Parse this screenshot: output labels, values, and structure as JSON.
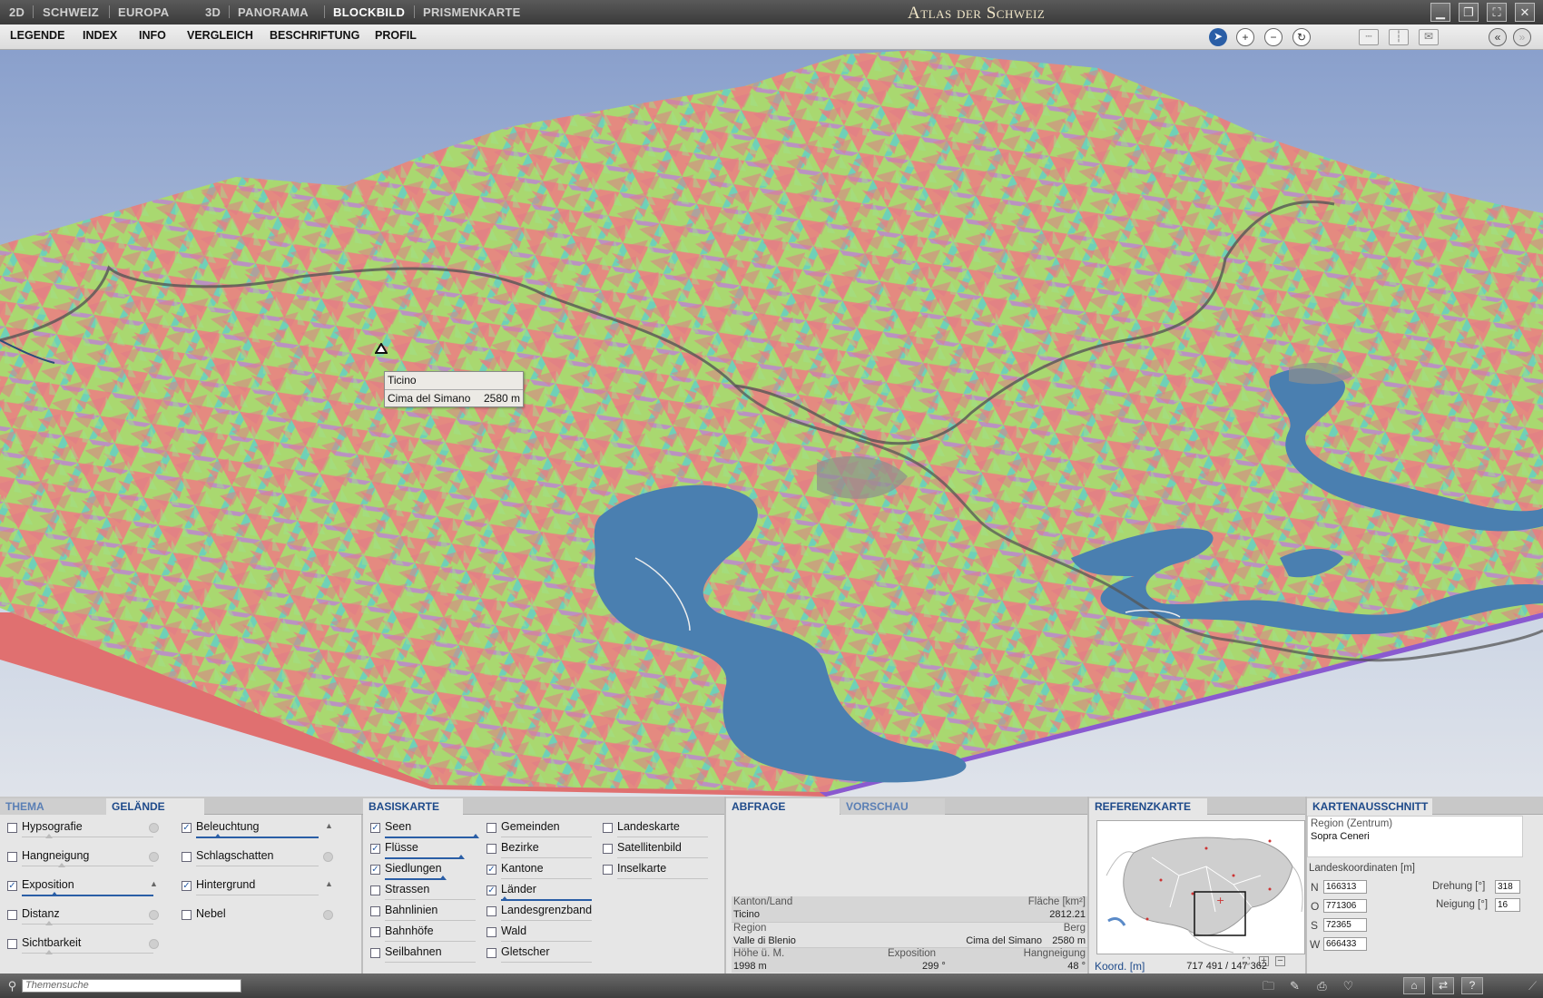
{
  "top": {
    "tabs": [
      "2D",
      "SCHWEIZ",
      "EUROPA",
      "3D",
      "PANORAMA",
      "BLOCKBILD",
      "PRISMENKARTE"
    ],
    "active_tab": "BLOCKBILD",
    "app_title": "Atlas der Schweiz"
  },
  "menu": {
    "items": [
      "LEGENDE",
      "INDEX",
      "INFO",
      "VERGLEICH",
      "BESCHRIFTUNG",
      "PROFIL"
    ]
  },
  "map": {
    "tooltip_region": "Ticino",
    "tooltip_peak": "Cima del Simano",
    "tooltip_height": "2580 m"
  },
  "thema": {
    "tabs": [
      "THEMA",
      "GELÄNDE"
    ],
    "items": [
      {
        "label": "Hypsografie",
        "checked": false
      },
      {
        "label": "Hangneigung",
        "checked": false
      },
      {
        "label": "Exposition",
        "checked": true
      },
      {
        "label": "Distanz",
        "checked": false
      },
      {
        "label": "Sichtbarkeit",
        "checked": false
      },
      {
        "label": "Beleuchtung",
        "checked": true
      },
      {
        "label": "Schlagschatten",
        "checked": false
      },
      {
        "label": "Hintergrund",
        "checked": true
      },
      {
        "label": "Nebel",
        "checked": false
      }
    ]
  },
  "basiskarte": {
    "title": "BASISKARTE",
    "col1": [
      {
        "label": "Seen",
        "checked": true
      },
      {
        "label": "Flüsse",
        "checked": true
      },
      {
        "label": "Siedlungen",
        "checked": true
      },
      {
        "label": "Strassen",
        "checked": false
      },
      {
        "label": "Bahnlinien",
        "checked": false
      },
      {
        "label": "Bahnhöfe",
        "checked": false
      },
      {
        "label": "Seilbahnen",
        "checked": false
      }
    ],
    "col2": [
      {
        "label": "Gemeinden",
        "checked": false
      },
      {
        "label": "Bezirke",
        "checked": false
      },
      {
        "label": "Kantone",
        "checked": true
      },
      {
        "label": "Länder",
        "checked": true
      },
      {
        "label": "Landesgrenzband",
        "checked": false
      },
      {
        "label": "Wald",
        "checked": false
      },
      {
        "label": "Gletscher",
        "checked": false
      }
    ],
    "col3": [
      {
        "label": "Landeskarte",
        "checked": false
      },
      {
        "label": "Satellitenbild",
        "checked": false
      },
      {
        "label": "Inselkarte",
        "checked": false
      }
    ]
  },
  "abfrage": {
    "tabs": [
      "ABFRAGE",
      "VORSCHAU"
    ],
    "kanton_label": "Kanton/Land",
    "kanton_value": "Ticino",
    "flaeche_label": "Fläche [km²]",
    "flaeche_value": "2812.21",
    "region_label": "Region",
    "region_value": "Valle di Blenio",
    "berg_label": "Berg",
    "berg_value": "Cima del Simano",
    "berg_height": "2580 m",
    "hoehe_label": "Höhe ü. M.",
    "hoehe_value": "1998 m",
    "exposition_label": "Exposition",
    "exposition_value": "299 °",
    "hangneigung_label": "Hangneigung",
    "hangneigung_value": "48 °"
  },
  "referenz": {
    "title": "REFERENZKARTE",
    "koord_label": "Koord. [m]",
    "koord_value": "717 491 / 147 362"
  },
  "ausschnitt": {
    "title": "KARTENAUSSCHNITT",
    "region_label": "Region (Zentrum)",
    "region_value": "Sopra Ceneri",
    "coords_label": "Landeskoordinaten [m]",
    "n_label": "N",
    "n_value": "166313",
    "o_label": "O",
    "o_value": "771306",
    "s_label": "S",
    "s_value": "72365",
    "w_label": "W",
    "w_value": "666433",
    "drehung_label": "Drehung [°]",
    "drehung_value": "318",
    "neigung_label": "Neigung [°]",
    "neigung_value": "16"
  },
  "status": {
    "search_placeholder": "Themensuche"
  },
  "colors": {
    "accent": "#2a5ea6",
    "lake": "#4a7fb0",
    "slope_north": "#a9d870",
    "slope_south": "#e48a80",
    "slope_east": "#6fd0b8",
    "slope_west": "#c07adc"
  }
}
